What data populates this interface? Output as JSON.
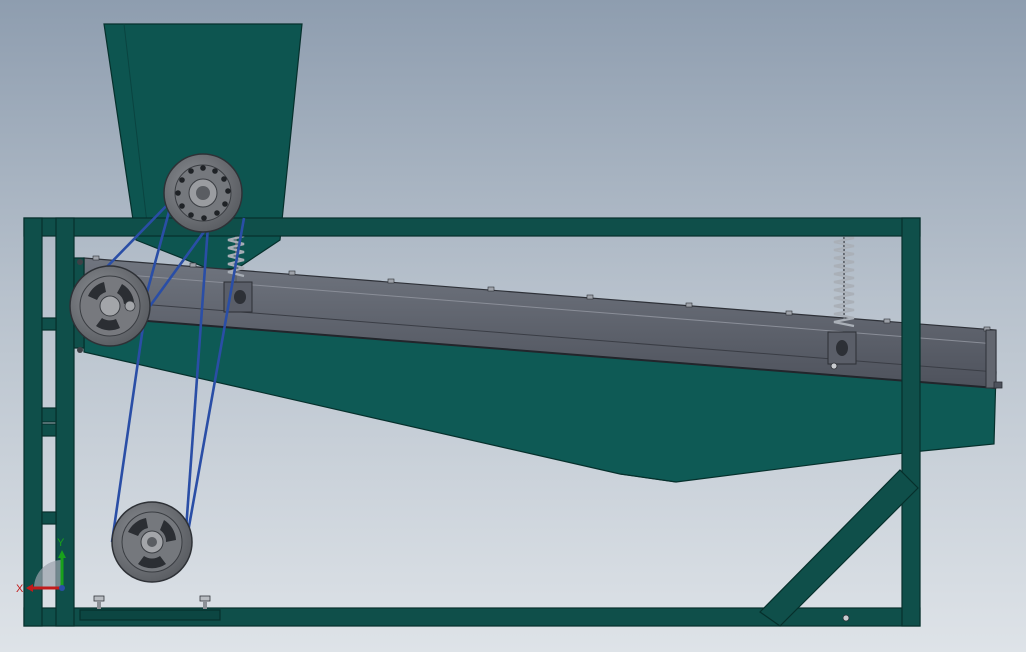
{
  "colors": {
    "frame": "#0f4f4a",
    "frame_edge": "#06302c",
    "hopper": "#0d5550",
    "trough": "#0e5a55",
    "screen_box": "#5b5f6c",
    "screen_box_light": "#6e7381",
    "pulley": "#6a6d72",
    "pulley_dark": "#3e4146",
    "belt": "#2a4ea6",
    "spring": "#9aa0a8",
    "axis_x": "#c21b1b",
    "axis_y": "#19a11c"
  },
  "triad": {
    "x_label": "X",
    "y_label": "Y"
  }
}
